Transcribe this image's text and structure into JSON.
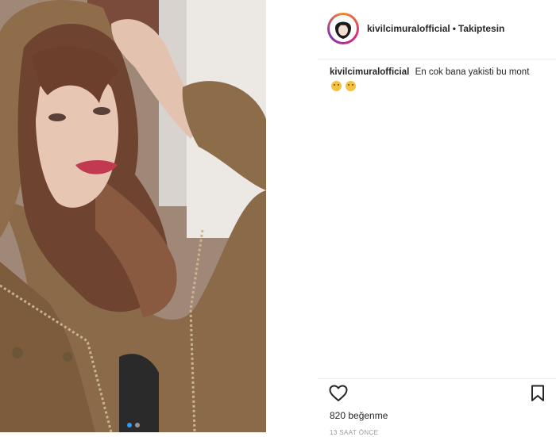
{
  "post": {
    "account": "kivilcimuralofficial",
    "separator": "•",
    "follow_status": "Takiptesin",
    "caption": {
      "user": "kivilcimuralofficial",
      "text": "En cok bana yakisti bu mont",
      "emojis": [
        "confused-face",
        "laughing-face"
      ]
    },
    "likes": "820 beğenme",
    "time": "13 SAAT ÖNCE",
    "carousel": {
      "count": 2,
      "active": 1
    }
  },
  "colors": {
    "accent": "#3897f0",
    "text": "#262626",
    "muted": "#999999",
    "divider": "#efefef"
  },
  "icons": {
    "like": "heart-icon",
    "save": "bookmark-icon"
  }
}
